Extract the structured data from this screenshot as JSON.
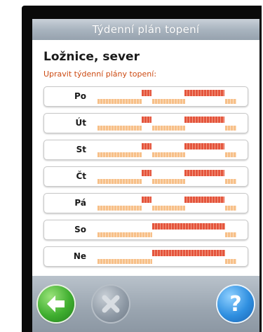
{
  "title_bar": {
    "title": "Týdenní plán topení"
  },
  "room": {
    "name": "Ložnice, sever"
  },
  "subtitle": "Upravit týdenní plány topení:",
  "days": [
    {
      "label": "Po",
      "schedule": [
        {
          "level": "low",
          "start": 0.0,
          "end": 0.31
        },
        {
          "level": "high",
          "start": 0.31,
          "end": 0.38
        },
        {
          "level": "low",
          "start": 0.38,
          "end": 0.61
        },
        {
          "level": "high",
          "start": 0.61,
          "end": 0.89
        },
        {
          "level": "low",
          "start": 0.89,
          "end": 0.97
        }
      ]
    },
    {
      "label": "Út",
      "schedule": [
        {
          "level": "low",
          "start": 0.0,
          "end": 0.31
        },
        {
          "level": "high",
          "start": 0.31,
          "end": 0.38
        },
        {
          "level": "low",
          "start": 0.38,
          "end": 0.61
        },
        {
          "level": "high",
          "start": 0.61,
          "end": 0.89
        },
        {
          "level": "low",
          "start": 0.89,
          "end": 0.97
        }
      ]
    },
    {
      "label": "St",
      "schedule": [
        {
          "level": "low",
          "start": 0.0,
          "end": 0.31
        },
        {
          "level": "high",
          "start": 0.31,
          "end": 0.38
        },
        {
          "level": "low",
          "start": 0.38,
          "end": 0.61
        },
        {
          "level": "high",
          "start": 0.61,
          "end": 0.89
        },
        {
          "level": "low",
          "start": 0.89,
          "end": 0.97
        }
      ]
    },
    {
      "label": "Čt",
      "schedule": [
        {
          "level": "low",
          "start": 0.0,
          "end": 0.31
        },
        {
          "level": "high",
          "start": 0.31,
          "end": 0.38
        },
        {
          "level": "low",
          "start": 0.38,
          "end": 0.61
        },
        {
          "level": "high",
          "start": 0.61,
          "end": 0.89
        },
        {
          "level": "low",
          "start": 0.89,
          "end": 0.97
        }
      ]
    },
    {
      "label": "Pá",
      "schedule": [
        {
          "level": "low",
          "start": 0.0,
          "end": 0.31
        },
        {
          "level": "high",
          "start": 0.31,
          "end": 0.38
        },
        {
          "level": "low",
          "start": 0.38,
          "end": 0.61
        },
        {
          "level": "high",
          "start": 0.61,
          "end": 0.89
        },
        {
          "level": "low",
          "start": 0.89,
          "end": 0.97
        }
      ]
    },
    {
      "label": "So",
      "schedule": [
        {
          "level": "low",
          "start": 0.0,
          "end": 0.38
        },
        {
          "level": "high",
          "start": 0.38,
          "end": 0.89
        },
        {
          "level": "low",
          "start": 0.89,
          "end": 0.97
        }
      ]
    },
    {
      "label": "Ne",
      "schedule": [
        {
          "level": "low",
          "start": 0.0,
          "end": 0.38
        },
        {
          "level": "high",
          "start": 0.38,
          "end": 0.89
        },
        {
          "level": "low",
          "start": 0.89,
          "end": 0.97
        }
      ]
    }
  ],
  "buttons": {
    "back": {
      "icon": "arrow-left-icon"
    },
    "cancel": {
      "icon": "close-icon",
      "state": "disabled"
    },
    "help": {
      "icon": "question-icon"
    }
  },
  "colors": {
    "low_temperature": "#f7c089",
    "high_temperature": "#e4553d",
    "subtitle": "#cc4a12",
    "back_button": "#3fae2f",
    "help_button": "#2f8fe0"
  }
}
